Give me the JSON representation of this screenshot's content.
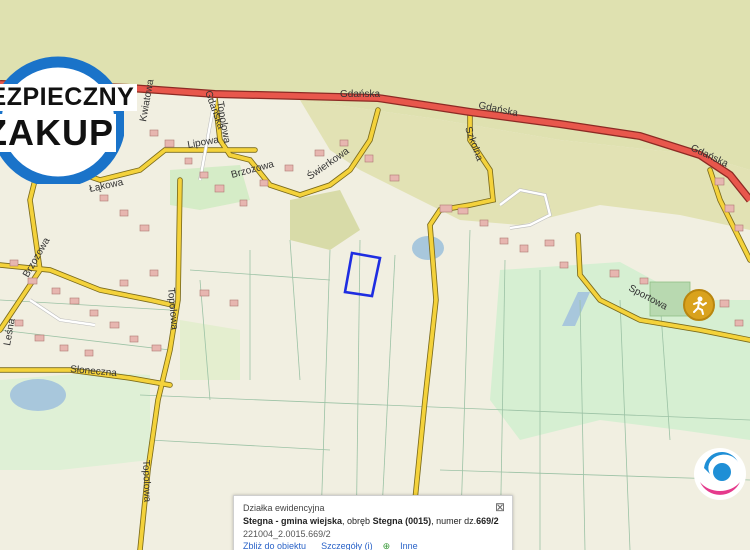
{
  "map": {
    "streets": [
      {
        "id": "gdanska-1",
        "text": "Gdańska"
      },
      {
        "id": "gdanska-2",
        "text": "Gdańska"
      },
      {
        "id": "gdanska-3",
        "text": "Gdańska"
      },
      {
        "id": "gdanska-4",
        "text": "Gdańska"
      },
      {
        "id": "kwiatowa",
        "text": "Kwiatowa"
      },
      {
        "id": "topolowa-1",
        "text": "Topolowa"
      },
      {
        "id": "lipowa",
        "text": "Lipowa"
      },
      {
        "id": "brzozowa",
        "text": "Brzozowa"
      },
      {
        "id": "wierzbowa",
        "text": "Świerkowa"
      },
      {
        "id": "lakowa",
        "text": "Łąkowa"
      },
      {
        "id": "szkolna",
        "text": "Szkolna"
      },
      {
        "id": "brzozowa2",
        "text": "Brzozowa"
      },
      {
        "id": "topolowa-2",
        "text": "Topolowa"
      },
      {
        "id": "sloneczna",
        "text": "Słoneczna"
      },
      {
        "id": "topolowa-3",
        "text": "Topolowa"
      },
      {
        "id": "sportowa",
        "text": "Sportowa"
      },
      {
        "id": "lesna",
        "text": "Leśna"
      }
    ],
    "colors": {
      "background": "#f1efe1",
      "forest": "#dfe1b0",
      "green": "#d4eecf",
      "main_road": "#e8574c",
      "road": "#f4d23b",
      "parcel": "#1e2de1"
    }
  },
  "badge": {
    "line1": "BEZPIECZNY",
    "line2": "ZAKUP"
  },
  "popup": {
    "title": "Działka ewidencyjna",
    "close": "⊠",
    "place": "Stegna - gmina wiejska",
    "sep1": ", obręb ",
    "precinct": "Stegna (0015)",
    "sep2": ", numer dz.",
    "parcel": "669/2",
    "parcel_id": "221004_2.0015.669/2",
    "zoom_link": "Zbliż do obiektu",
    "details_link": "Szczegóły (i)",
    "more_link": "Inne"
  }
}
